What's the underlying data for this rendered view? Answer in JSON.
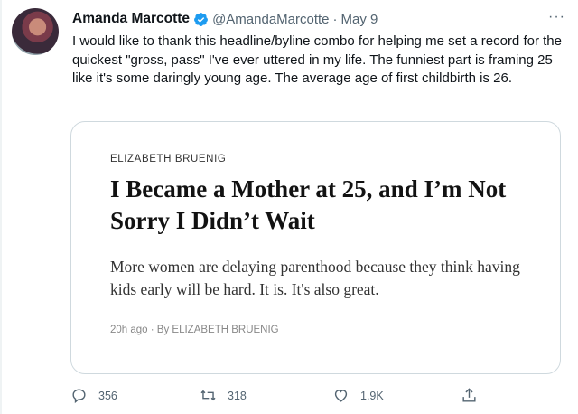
{
  "tweet": {
    "display_name": "Amanda Marcotte",
    "handle": "@AmandaMarcotte",
    "separator": "·",
    "date": "May 9",
    "more_label": "···",
    "text": "I would like to thank this headline/byline combo for helping me set a record for the quickest \"gross, pass\" I've ever uttered in my life. The funniest part is framing 25 like it's some daringly young age. The average age of first childbirth is 26."
  },
  "card": {
    "byline": "ELIZABETH BRUENIG",
    "headline": "I Became a Mother at 25, and I’m Not Sorry I Didn’t Wait",
    "summary": "More women are delaying parenthood because they think having kids early will be hard. It is. It's also great.",
    "meta": "20h ago · By ELIZABETH BRUENIG"
  },
  "actions": {
    "reply_count": "356",
    "retweet_count": "318",
    "like_count": "1.9K",
    "icons": [
      "reply-icon",
      "retweet-icon",
      "like-icon",
      "share-icon"
    ]
  },
  "colors": {
    "verified": "#1d9bf0",
    "muted": "#536471"
  }
}
